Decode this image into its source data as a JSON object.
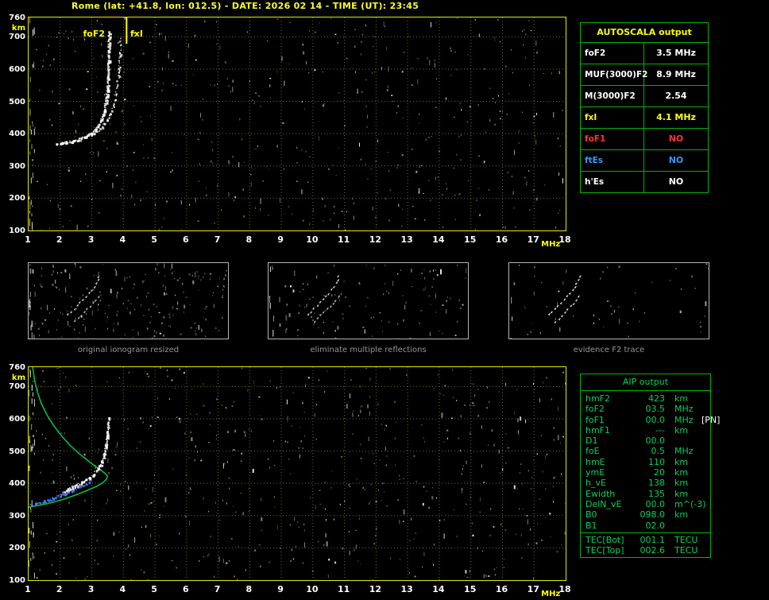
{
  "title": "Rome (lat: +41.8, lon: 012.5) - DATE: 2026 02 14 - TIME (UT): 23:45",
  "colors": {
    "background": "#000000",
    "title": "#ffff22",
    "plot_border": "#e8e800",
    "grid": "#85851c",
    "axis_number": "#ffffff",
    "axis_unit": "#ffff00",
    "table_border": "#00b400",
    "aip_text": "#00d060",
    "white_trace": "#ffffff",
    "blue_trace": "#4f7dff",
    "green_profile": "#00c040",
    "fxI_line": "#ffff00"
  },
  "ionogram": {
    "x_ticks": [
      "1",
      "2",
      "3",
      "4",
      "5",
      "6",
      "7",
      "8",
      "9",
      "10",
      "11",
      "12",
      "13",
      "14",
      "15",
      "16",
      "17",
      "18"
    ],
    "x_unit": "MHz",
    "y_ticks": [
      "760",
      "700",
      "600",
      "500",
      "400",
      "300",
      "200",
      "100"
    ],
    "y_unit": "km",
    "x_range": [
      1,
      18
    ],
    "y_range": [
      100,
      760
    ],
    "annotations": {
      "foF2_label": "foF2",
      "fxI_label": "fxI",
      "foF2_freq": 3.5,
      "fxI_freq": 4.1
    }
  },
  "autoscala_table": {
    "header": "AUTOSCALA output",
    "rows": [
      {
        "label": "foF2",
        "value": "3.5 MHz",
        "color": "#ffffff"
      },
      {
        "label": "MUF(3000)F2",
        "value": "8.9 MHz",
        "color": "#ffffff"
      },
      {
        "label": "M(3000)F2",
        "value": "2.54",
        "color": "#ffffff"
      },
      {
        "label": "fxI",
        "value": "4.1 MHz",
        "color": "#ffff00"
      },
      {
        "label": "foF1",
        "value": "NO",
        "color": "#ff3333"
      },
      {
        "label": "ftEs",
        "value": "NO",
        "color": "#3399ff"
      },
      {
        "label": "h'Es",
        "value": "NO",
        "color": "#ffffff"
      }
    ]
  },
  "thumbnails": [
    {
      "caption": "original ionogram resized"
    },
    {
      "caption": "eliminate multiple reflections"
    },
    {
      "caption": "evidence F2 trace"
    }
  ],
  "aip_table": {
    "header": "AIP output",
    "rows": [
      {
        "label": "hmF2",
        "value": "423",
        "unit": "km",
        "extra": ""
      },
      {
        "label": "foF2",
        "value": "03.5",
        "unit": "MHz",
        "extra": ""
      },
      {
        "label": "foF1",
        "value": "00.0",
        "unit": "MHz",
        "extra": "[PN]"
      },
      {
        "label": "hmF1",
        "value": "---",
        "unit": "km",
        "extra": ""
      },
      {
        "label": "D1",
        "value": "00.0",
        "unit": "",
        "extra": ""
      },
      {
        "label": "foE",
        "value": "0.5",
        "unit": "MHz",
        "extra": ""
      },
      {
        "label": "hmE",
        "value": "110",
        "unit": "km",
        "extra": ""
      },
      {
        "label": "ymE",
        "value": "20",
        "unit": "km",
        "extra": ""
      },
      {
        "label": "h_vE",
        "value": "138",
        "unit": "km",
        "extra": ""
      },
      {
        "label": "Ewidth",
        "value": "135",
        "unit": "km",
        "extra": ""
      },
      {
        "label": "DelN_vE",
        "value": "00.0",
        "unit": "m^(-3)",
        "extra": ""
      },
      {
        "label": "B0",
        "value": "098.0",
        "unit": "km",
        "extra": ""
      },
      {
        "label": "B1",
        "value": "02.0",
        "unit": "",
        "extra": ""
      }
    ],
    "tec_rows": [
      {
        "label": "TEC[Bot]",
        "value": "001.1",
        "unit": "TECU"
      },
      {
        "label": "TEC[Top]",
        "value": "002.6",
        "unit": "TECU"
      }
    ]
  },
  "chart_data": {
    "type": "scatter",
    "xlabel": "MHz",
    "ylabel": "km",
    "xlim": [
      1,
      18
    ],
    "ylim": [
      100,
      760
    ],
    "top_ionogram": {
      "o_trace": [
        [
          1.85,
          368
        ],
        [
          2.0,
          371
        ],
        [
          2.2,
          374
        ],
        [
          2.4,
          378
        ],
        [
          2.6,
          384
        ],
        [
          2.8,
          392
        ],
        [
          2.95,
          401
        ],
        [
          3.1,
          413
        ],
        [
          3.2,
          427
        ],
        [
          3.3,
          446
        ],
        [
          3.38,
          470
        ],
        [
          3.44,
          500
        ],
        [
          3.48,
          538
        ],
        [
          3.5,
          578
        ],
        [
          3.52,
          625
        ],
        [
          3.53,
          672
        ],
        [
          3.54,
          715
        ]
      ],
      "x_trace": [
        [
          2.55,
          384
        ],
        [
          2.75,
          390
        ],
        [
          2.95,
          398
        ],
        [
          3.15,
          409
        ],
        [
          3.3,
          422
        ],
        [
          3.45,
          440
        ],
        [
          3.55,
          460
        ],
        [
          3.65,
          486
        ],
        [
          3.73,
          518
        ],
        [
          3.8,
          556
        ],
        [
          3.85,
          600
        ],
        [
          3.88,
          648
        ],
        [
          3.9,
          695
        ]
      ],
      "foF2_MHz": 3.5,
      "fxI_MHz": 4.1
    },
    "bottom_ionogram": {
      "restored_trace_blue": [
        [
          1.05,
          332
        ],
        [
          1.25,
          338
        ],
        [
          1.5,
          346
        ],
        [
          1.75,
          355
        ],
        [
          2.0,
          364
        ],
        [
          2.2,
          372
        ],
        [
          2.4,
          381
        ],
        [
          2.6,
          391
        ],
        [
          2.8,
          401
        ],
        [
          2.95,
          410
        ]
      ],
      "scaled_trace_white": [
        [
          2.1,
          378
        ],
        [
          2.3,
          386
        ],
        [
          2.5,
          395
        ],
        [
          2.7,
          405
        ],
        [
          2.9,
          417
        ],
        [
          3.05,
          430
        ],
        [
          3.2,
          447
        ],
        [
          3.3,
          466
        ],
        [
          3.38,
          490
        ],
        [
          3.44,
          518
        ],
        [
          3.48,
          550
        ],
        [
          3.51,
          585
        ],
        [
          3.52,
          605
        ]
      ],
      "profile_green": [
        [
          1.13,
          760
        ],
        [
          1.18,
          724
        ],
        [
          1.27,
          686
        ],
        [
          1.4,
          648
        ],
        [
          1.58,
          612
        ],
        [
          1.8,
          578
        ],
        [
          2.05,
          546
        ],
        [
          2.32,
          517
        ],
        [
          2.6,
          492
        ],
        [
          2.88,
          470
        ],
        [
          3.12,
          452
        ],
        [
          3.3,
          440
        ],
        [
          3.43,
          430
        ],
        [
          3.5,
          423
        ],
        [
          3.46,
          412
        ],
        [
          3.35,
          402
        ],
        [
          3.18,
          392
        ],
        [
          2.95,
          382
        ],
        [
          2.68,
          371
        ],
        [
          2.38,
          360
        ],
        [
          2.05,
          349
        ],
        [
          1.72,
          340
        ],
        [
          1.4,
          333
        ],
        [
          1.12,
          328
        ],
        [
          0.95,
          325
        ]
      ]
    }
  }
}
